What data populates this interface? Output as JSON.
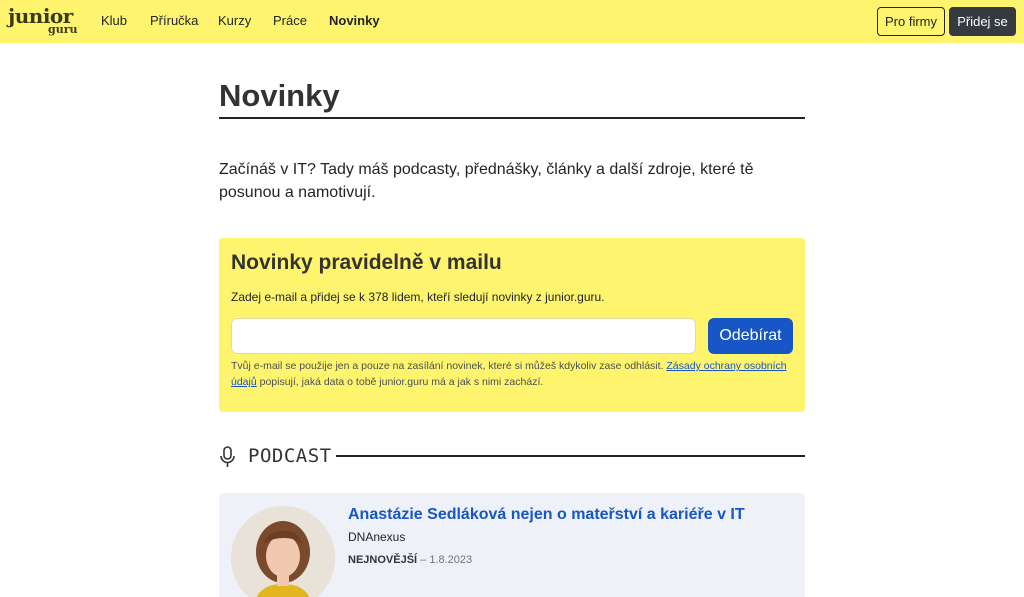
{
  "logo": {
    "line1": "junior",
    "line2": "guru"
  },
  "nav": {
    "items": [
      "Klub",
      "Příručka",
      "Kurzy",
      "Práce",
      "Novinky"
    ],
    "active": "Novinky",
    "pro_firmy": "Pro firmy",
    "pridej_se": "Přidej se"
  },
  "page": {
    "title": "Novinky",
    "lead": "Začínáš v IT? Tady máš podcasty, přednášky, články a další zdroje, které tě posunou a namotivují."
  },
  "newsletter": {
    "title": "Novinky pravidelně v mailu",
    "description": "Zadej e-mail a přidej se k 378 lidem, kteří sledují novinky z junior.guru.",
    "email_value": "",
    "button": "Odebírat",
    "note_before": "Tvůj e-mail se použije jen a pouze na zasílání novinek, které si můžeš kdykoliv zase odhlásit. ",
    "note_link": "Zásady ochrany osobních údajů",
    "note_after": " popisují, jaká data o tobě junior.guru má a jak s nimi zachází."
  },
  "section": {
    "label": "PODCAST",
    "icon": "microphone-icon"
  },
  "episode": {
    "title": "Anastázie Sedláková nejen o mateřství a kariéře v IT",
    "company": "DNAnexus",
    "badge": "NEJNOVĚJŠÍ",
    "date_sep": " – ",
    "date": "1.8.2023"
  },
  "colors": {
    "brand_yellow": "#fff46e",
    "link_blue": "#1756c4",
    "dark": "#343a40",
    "card_bg": "#eef2f8"
  }
}
